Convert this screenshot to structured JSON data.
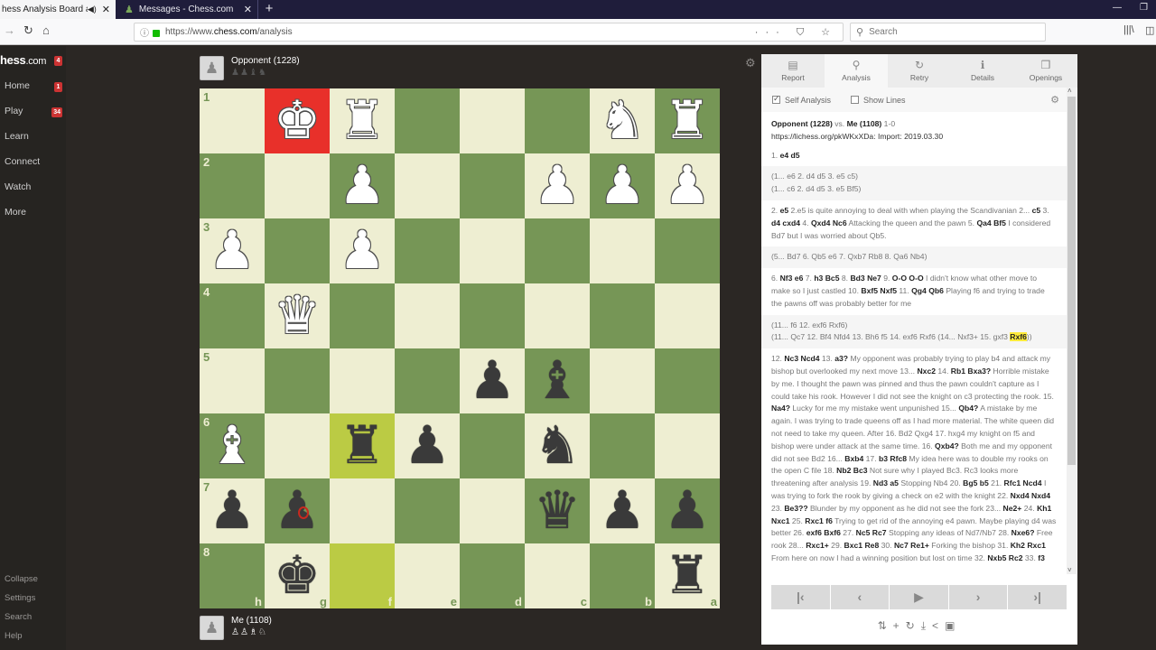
{
  "browser": {
    "tabs": [
      {
        "title": "hess Analysis Board and P",
        "active": true,
        "audio_icon": "speaker-icon"
      },
      {
        "title": "Messages - Chess.com",
        "active": false
      }
    ],
    "new_tab": "+",
    "url_prefix": "https://www.",
    "url_domain": "chess.com",
    "url_path": "/analysis",
    "search_placeholder": "Search",
    "url_actions": "··· ⛉ ☆"
  },
  "sidebar": {
    "logo_main": "hess",
    "logo_suffix": ".com",
    "logo_badge": "4",
    "items": [
      {
        "label": "Home",
        "badge": "1"
      },
      {
        "label": "Play",
        "badge": "34"
      },
      {
        "label": "Learn",
        "badge": ""
      },
      {
        "label": "Connect",
        "badge": ""
      },
      {
        "label": "Watch",
        "badge": ""
      },
      {
        "label": "More",
        "badge": ""
      }
    ],
    "bottom": [
      "Collapse",
      "Settings",
      "Search",
      "Help"
    ]
  },
  "opponent": {
    "name": "Opponent (1228)",
    "captured": "♟♟♝♞"
  },
  "me": {
    "name": "Me (1108)",
    "captured": "♙♙♗♘"
  },
  "board": {
    "orientation": "black",
    "files": [
      "h",
      "g",
      "f",
      "e",
      "d",
      "c",
      "b",
      "a"
    ],
    "ranks": [
      "1",
      "2",
      "3",
      "4",
      "5",
      "6",
      "7",
      "8"
    ],
    "rows": [
      [
        "",
        "wK",
        "wR",
        "",
        "",
        "",
        "wN",
        "wR"
      ],
      [
        "",
        "",
        "wP",
        "",
        "",
        "wP",
        "wP",
        "wP"
      ],
      [
        "wP",
        "",
        "wP",
        "",
        "",
        "",
        "",
        ""
      ],
      [
        "",
        "wQ",
        "",
        "",
        "",
        "",
        "",
        ""
      ],
      [
        "",
        "",
        "",
        "",
        "bP",
        "bB",
        "",
        ""
      ],
      [
        "wB",
        "",
        "bR",
        "bP",
        "",
        "bN",
        "",
        ""
      ],
      [
        "bP",
        "bP",
        "",
        "",
        "",
        "bQ",
        "bP",
        "bP"
      ],
      [
        "",
        "bK",
        "",
        "",
        "",
        "",
        "",
        "bR"
      ]
    ],
    "check_square": "g1",
    "highlight_squares": [
      "f6",
      "f8"
    ]
  },
  "panel": {
    "tabs": [
      {
        "label": "Report",
        "icon": "report-icon",
        "glyph": "▤"
      },
      {
        "label": "Analysis",
        "icon": "analysis-icon",
        "glyph": "⚲",
        "active": true
      },
      {
        "label": "Retry",
        "icon": "retry-icon",
        "glyph": "↻"
      },
      {
        "label": "Details",
        "icon": "info-icon",
        "glyph": "ℹ"
      },
      {
        "label": "Openings",
        "icon": "openings-icon",
        "glyph": "❒"
      }
    ],
    "options": [
      {
        "label": "Self Analysis",
        "checked": true
      },
      {
        "label": "Show Lines",
        "checked": false
      }
    ],
    "header": {
      "white": "Opponent (1228)",
      "vs": "vs.",
      "black": "Me (1108)",
      "result": "1-0",
      "source": "https://lichess.org/pkWKxXDa: Import: 2019.03.30"
    },
    "blocks": [
      {
        "alt": false,
        "html": "1. <b>e4 d5</b>"
      },
      {
        "alt": true,
        "html": "(1... e6 2. d4 d5 3. e5 c5)<br>(1... c6 2. d4 d5 3. e5 Bf5)"
      },
      {
        "alt": false,
        "html": "2. <b>e5</b> 2.e5 is quite annoying to deal with when playing the Scandivanian 2... <b>c5</b> 3. <b>d4 cxd4</b> 4. <b>Qxd4 Nc6</b> Attacking the queen and the pawn 5. <b>Qa4 Bf5</b> I considered Bd7 but I was worried about Qb5."
      },
      {
        "alt": true,
        "html": "(5... Bd7 6. Qb5 e6 7. Qxb7 Rb8 8. Qa6 Nb4)"
      },
      {
        "alt": false,
        "html": "6. <b>Nf3 e6</b> 7. <b>h3 Bc5</b> 8. <b>Bd3 Ne7</b> 9. <b>O-O O-O</b> I didn't know what other move to make so I just castled 10. <b>Bxf5 Nxf5</b> 11. <b>Qg4 Qb6</b> Playing f6 and trying to trade the pawns off was probably better for me"
      },
      {
        "alt": true,
        "html": "(11... f6 12. exf6 Rxf6)<br>(11... Qc7 12. Bf4 Nfd4 13. Bh6 f5 14. exf6 Rxf6 (14... Nxf3+ 15. gxf3 <span class=\"mark\">Rxf6</span>))"
      },
      {
        "alt": false,
        "html": "12. <b>Nc3 Ncd4</b> 13. <b>a3?</b> My opponent was probably trying to play b4 and attack my bishop but overlooked my next move 13... <b>Nxc2</b> 14. <b>Rb1 Bxa3?</b> Horrible mistake by me. I thought the pawn was pinned and thus the pawn couldn't capture as I could take his rook. However I did not see the knight on c3 protecting the rook. 15. <b>Na4?</b> Lucky for me my mistake went unpunished 15... <b>Qb4?</b> A mistake by me again. I was trying to trade queens off as I had more material. The white queen did not need to take my queen. After 16. Bd2 Qxg4 17. hxg4 my knight on f5 and bishop were under attack at the same time. 16. <b>Qxb4?</b> Both me and my opponent did not see Bd2 16... <b>Bxb4</b> 17. <b>b3 Rfc8</b> My idea here was to double my rooks on the open C file 18. <b>Nb2 Bc3</b> Not sure why I played Bc3. Rc3 looks more threatening after analysis 19. <b>Nd3 a5</b> Stopping Nb4 20. <b>Bg5 b5</b> 21. <b>Rfc1 Ncd4</b> I was trying to fork the rook by giving a check on e2 with the knight 22. <b>Nxd4 Nxd4</b> 23. <b>Be3??</b> Blunder by my opponent as he did not see the fork 23... <b>Ne2+</b> 24. <b>Kh1 Nxc1</b> 25. <b>Rxc1 f6</b> Trying to get rid of the annoying e4 pawn. Maybe playing d4 was better 26. <b>exf6 Bxf6</b> 27. <b>Nc5 Rc7</b> Stopping any ideas of Nd7/Nb7 28. <b>Nxe6?</b> Free rook 28... <b>Rxc1+</b> 29. <b>Bxc1 Re8</b> 30. <b>Nc7 Re1+</b> Forking the bishop 31. <b>Kh2 Rxc1</b> From here on now I had a winning position but lost on time 32. <b>Nxb5 Rc2</b> 33. <b>f3</b>"
      }
    ],
    "controls": [
      "K",
      "‹",
      "▶",
      "›",
      "›I"
    ],
    "tools": [
      "flip-icon",
      "add-icon",
      "reset-icon",
      "download-icon",
      "share-icon",
      "computer-icon"
    ],
    "tool_glyphs": [
      "⇅",
      "+",
      "↻",
      "⤓",
      "<",
      "▣"
    ]
  }
}
